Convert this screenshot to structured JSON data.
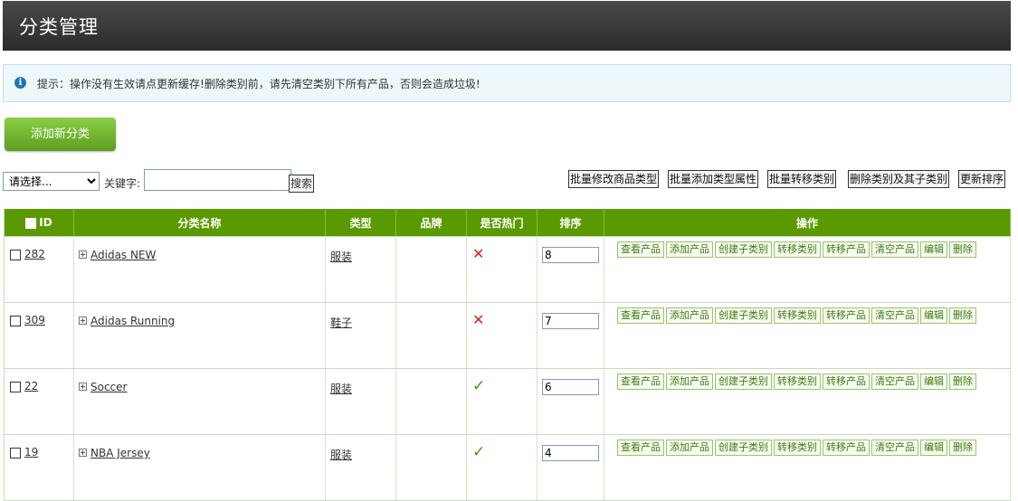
{
  "header": {
    "title": "分类管理"
  },
  "notice": {
    "icon": "info-icon",
    "text": "提示：操作没有生效请点更新缓存!删除类别前，请先清空类别下所有产品，否则会造成垃圾!"
  },
  "toolbar": {
    "add_label": "添加新分类"
  },
  "filter": {
    "select_value": "请选择...",
    "keyword_label": "关键字:",
    "keyword_value": "",
    "search_label": "搜索"
  },
  "batch": {
    "modify_type": "批量修改商品类型",
    "add_attr": "批量添加类型属性",
    "move_category": "批量转移类别",
    "delete_with_children": "删除类别及其子类别",
    "update_sort": "更新排序"
  },
  "table": {
    "headers": {
      "id": "ID",
      "name": "分类名称",
      "type": "类型",
      "brand": "品牌",
      "hot": "是否热门",
      "sort": "排序",
      "ops": "操作"
    },
    "op_labels": {
      "view": "查看产品",
      "add": "添加产品",
      "create_child": "创建子类别",
      "move_cat": "转移类别",
      "move_prod": "转移产品",
      "clear": "清空产品",
      "edit": "编辑",
      "delete": "删除"
    },
    "rows": [
      {
        "id": "282",
        "name": "Adidas NEW",
        "type": "服装",
        "brand": "",
        "hot": "cross-icon",
        "sort": "8"
      },
      {
        "id": "309",
        "name": "Adidas Running",
        "type": "鞋子",
        "brand": "",
        "hot": "cross-icon",
        "sort": "7"
      },
      {
        "id": "22",
        "name": "Soccer",
        "type": "服装",
        "brand": "",
        "hot": "check-icon",
        "sort": "6"
      },
      {
        "id": "19",
        "name": "NBA Jersey",
        "type": "服装",
        "brand": "",
        "hot": "check-icon",
        "sort": "4"
      }
    ]
  },
  "colors": {
    "header_bg": "#333333",
    "table_header": "#5a9a00",
    "button_green": "#6db22c",
    "op_text": "#3f7b14"
  }
}
